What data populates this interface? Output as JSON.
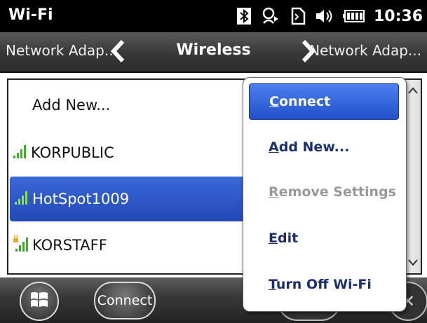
{
  "status_bar": {
    "title": "Wi-Fi",
    "time": "10:36",
    "icons": [
      "bluetooth-icon",
      "sync-icon",
      "sim-icon",
      "volume-icon",
      "battery-icon"
    ]
  },
  "nav": {
    "prev": "Network Adap...",
    "current": "Wireless",
    "next": "Network Adap..."
  },
  "networks": [
    {
      "label": "Add New...",
      "signal": false
    },
    {
      "label": "KORPUBLIC",
      "signal": true
    },
    {
      "label": "HotSpot1009",
      "signal": true,
      "selected": true
    },
    {
      "label": "KORSTAFF",
      "signal": true,
      "locked": true
    }
  ],
  "menu": {
    "items": [
      {
        "first": "C",
        "rest": "onnect",
        "state": "active"
      },
      {
        "first": "A",
        "rest": "dd New...",
        "state": "normal"
      },
      {
        "first": "R",
        "rest": "emove Settings",
        "state": "disabled"
      },
      {
        "first": "E",
        "rest": "dit",
        "state": "normal"
      },
      {
        "first": "T",
        "rest": "urn Off Wi-Fi",
        "state": "normal"
      }
    ]
  },
  "appbar": {
    "connect_label": "Connect"
  },
  "colors": {
    "selection": "#2a55c8",
    "menu_text": "#1b2f6e",
    "signal": "#3fae2a"
  }
}
